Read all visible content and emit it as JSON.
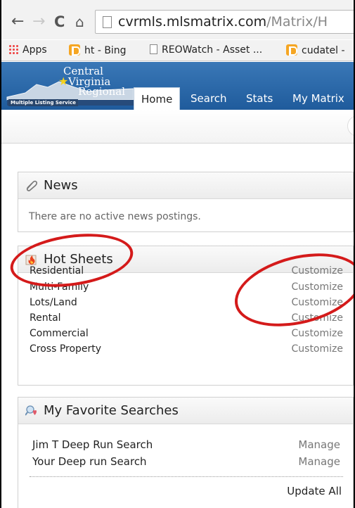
{
  "browser": {
    "url_host": "cvrmls.mlsmatrix.com",
    "url_path": "/Matrix/H",
    "bookmarks": [
      {
        "label": "Apps",
        "icon": "apps-grid-icon"
      },
      {
        "label": "ht - Bing",
        "icon": "bing-icon"
      },
      {
        "label": "REOWatch - Asset ...",
        "icon": "page-icon"
      },
      {
        "label": "cudatel -",
        "icon": "bing-icon"
      }
    ]
  },
  "logo": {
    "line1": "Central",
    "line2": "Virginia",
    "line3": "Regional",
    "tagline": "Multiple Listing Service"
  },
  "nav": {
    "tabs": [
      "Home",
      "Search",
      "Stats",
      "My Matrix"
    ],
    "active": "Home"
  },
  "news": {
    "title": "News",
    "empty_text": "There are no active news postings."
  },
  "hot_sheets": {
    "title": "Hot Sheets",
    "action_label": "Customize",
    "rows": [
      "Residential",
      "Multi-Family",
      "Lots/Land",
      "Rental",
      "Commercial",
      "Cross Property"
    ]
  },
  "favorites": {
    "title": "My Favorite Searches",
    "action_label": "Manage",
    "rows": [
      "Jim T Deep Run Search",
      "Your Deep run Search"
    ],
    "update_all": "Update All"
  },
  "colors": {
    "header_blue": "#2a6aad",
    "annotation_red": "#d41a1a"
  }
}
